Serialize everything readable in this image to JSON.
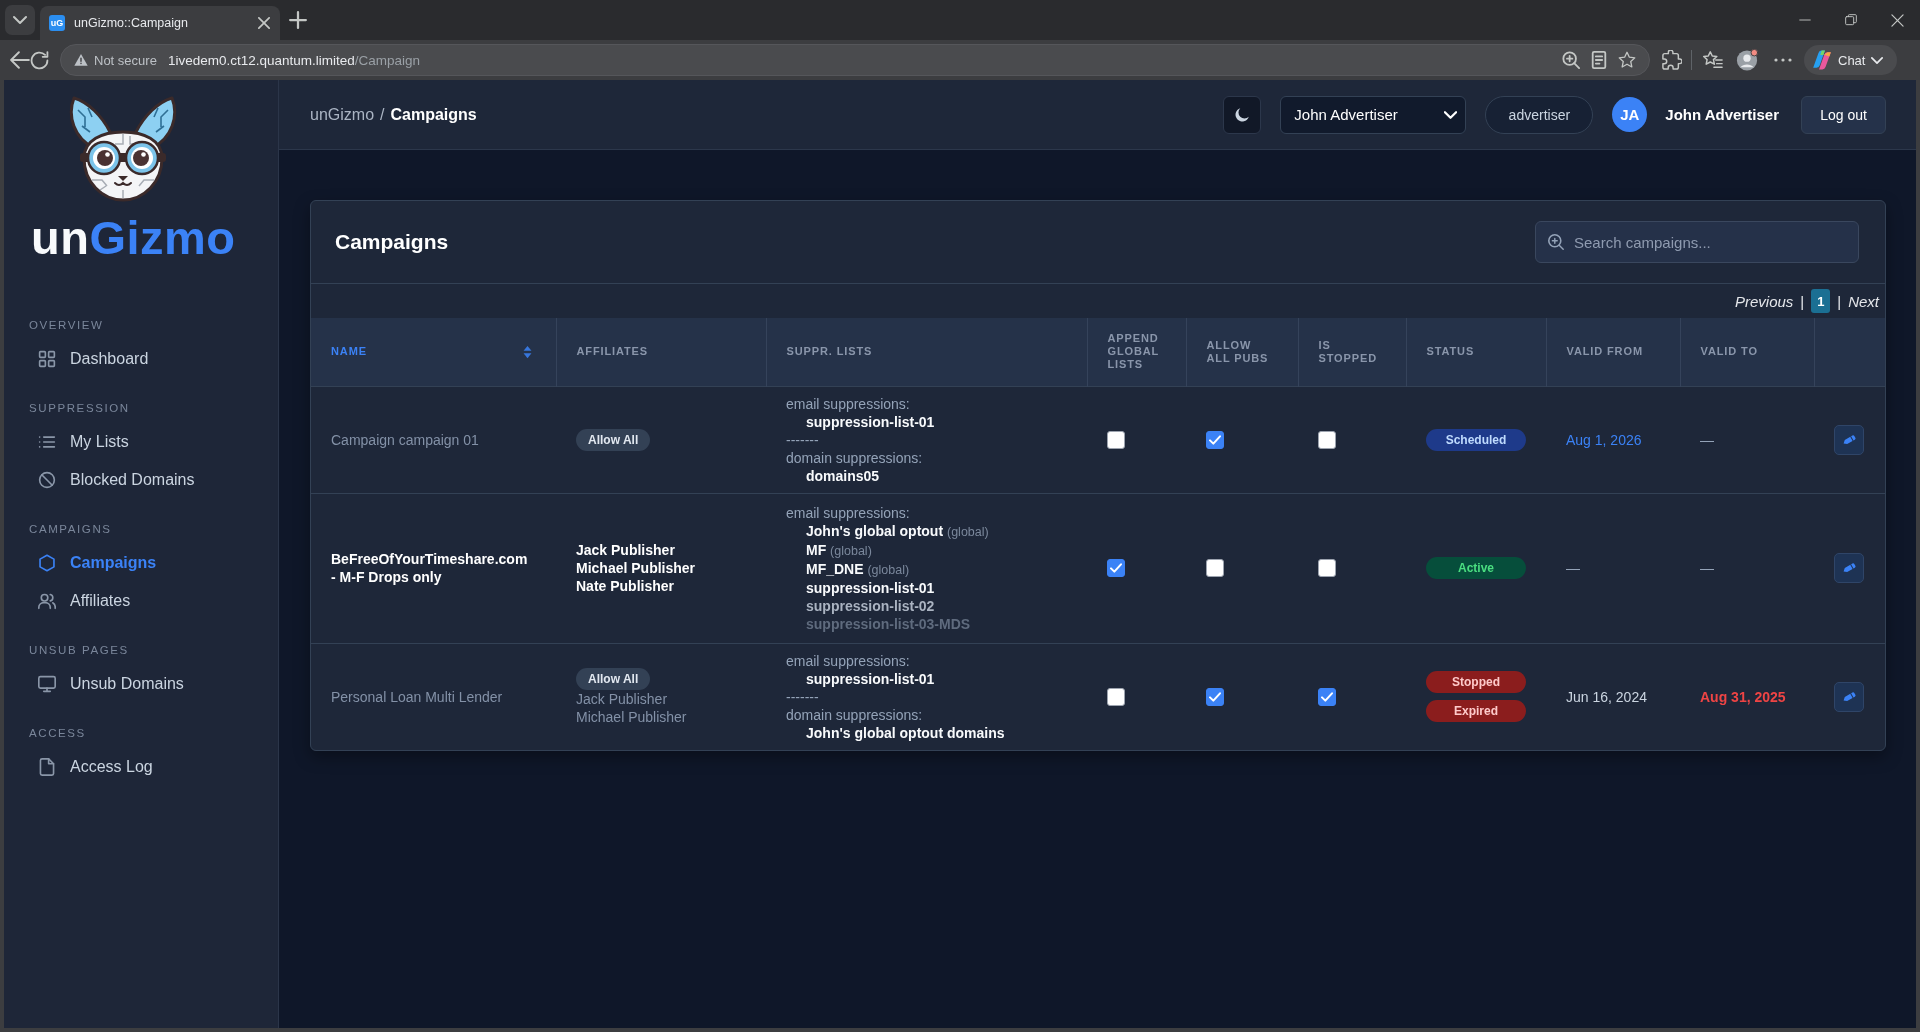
{
  "browser": {
    "tab": {
      "favicon": "uG",
      "title": "unGizmo::Campaign"
    },
    "address": {
      "security": "Not secure",
      "host": "1ivedem0.ct12.quantum.limited",
      "path": "/Campaign"
    },
    "chat": "Chat"
  },
  "sidebar": {
    "logo": {
      "wordmark_start": "un",
      "wordmark_end": "Gizmo"
    },
    "sections": [
      {
        "title": "OVERVIEW",
        "items": [
          {
            "label": "Dashboard",
            "selected": false
          }
        ]
      },
      {
        "title": "SUPPRESSION",
        "items": [
          {
            "label": "My Lists",
            "selected": false
          },
          {
            "label": "Blocked Domains",
            "selected": false
          }
        ]
      },
      {
        "title": "CAMPAIGNS",
        "items": [
          {
            "label": "Campaigns",
            "selected": true
          },
          {
            "label": "Affiliates",
            "selected": false
          }
        ]
      },
      {
        "title": "UNSUB PAGES",
        "items": [
          {
            "label": "Unsub Domains",
            "selected": false
          }
        ]
      },
      {
        "title": "ACCESS",
        "items": [
          {
            "label": "Access Log",
            "selected": false
          }
        ]
      }
    ]
  },
  "header": {
    "breadcrumb": [
      {
        "label": "unGizmo",
        "current": false
      },
      {
        "label": "Campaigns",
        "current": true
      }
    ],
    "breadcrumb_separator": "/",
    "account_select": "John Advertiser",
    "role": "advertiser",
    "avatar_initials": "JA",
    "user_name": "John Advertiser",
    "logout": "Log out"
  },
  "card": {
    "title": "Campaigns",
    "search": {
      "placeholder": "Search campaigns..."
    },
    "pagination": {
      "previous": "Previous",
      "separators": [
        "|",
        "|"
      ],
      "pages": [
        {
          "label": "1",
          "selected": true
        }
      ],
      "next": "Next"
    },
    "table": {
      "columns": [
        {
          "label": "NAME",
          "sorted": true
        },
        {
          "label": "AFFILIATES",
          "sorted": false
        },
        {
          "label": "SUPPR. LISTS",
          "sorted": false
        },
        {
          "label": "APPEND GLOBAL LISTS",
          "sorted": false
        },
        {
          "label": "ALLOW ALL PUBS",
          "sorted": false
        },
        {
          "label": "IS STOPPED",
          "sorted": false
        },
        {
          "label": "STATUS",
          "sorted": false
        },
        {
          "label": "VALID FROM",
          "sorted": false
        },
        {
          "label": "VALID TO",
          "sorted": false
        }
      ],
      "rows": [
        {
          "name": "Campaign campaign 01",
          "inactive": true,
          "affiliates": {
            "badge": "Allow All"
          },
          "suppr_overflow": false,
          "suppr_lists": [
            {
              "kind": "heading",
              "text": "email suppressions:"
            },
            {
              "kind": "list",
              "text": "suppression-list-01"
            },
            {
              "kind": "divider",
              "text": "-------"
            },
            {
              "kind": "heading",
              "text": "domain suppressions:"
            },
            {
              "kind": "list",
              "text": "domains05"
            }
          ],
          "append_global": false,
          "allow_all_pubs": true,
          "is_stopped": false,
          "status": [
            {
              "label": "Scheduled",
              "kind": "scheduled"
            }
          ],
          "valid_from": {
            "text": "Aug 1, 2026",
            "kind": "future"
          },
          "valid_to": {
            "text": "—",
            "kind": "none"
          }
        },
        {
          "name": "BeFreeOfYourTimeshare.com - M-F Drops only",
          "inactive": false,
          "affiliates": {
            "names": [
              "Jack Publisher",
              "Michael Publisher",
              "Nate Publisher"
            ]
          },
          "suppr_overflow": true,
          "suppr_lists": [
            {
              "kind": "heading",
              "text": "email suppressions:"
            },
            {
              "kind": "list",
              "text": "John's global optout",
              "tag": "(global)"
            },
            {
              "kind": "list",
              "text": "MF",
              "tag": "(global)"
            },
            {
              "kind": "list",
              "text": "MF_DNE",
              "tag": "(global)"
            },
            {
              "kind": "list",
              "text": "suppression-list-01"
            },
            {
              "kind": "list",
              "text": "suppression-list-02"
            },
            {
              "kind": "list",
              "text": "suppression-list-03-MDS"
            }
          ],
          "append_global": true,
          "allow_all_pubs": false,
          "is_stopped": false,
          "status": [
            {
              "label": "Active",
              "kind": "active"
            }
          ],
          "valid_from": {
            "text": "—",
            "kind": "none"
          },
          "valid_to": {
            "text": "—",
            "kind": "none"
          }
        },
        {
          "name": "Personal Loan Multi Lender",
          "inactive": true,
          "affiliates": {
            "badge": "Allow All",
            "names": [
              "Jack Publisher",
              "Michael Publisher"
            ]
          },
          "suppr_overflow": false,
          "suppr_lists": [
            {
              "kind": "heading",
              "text": "email suppressions:"
            },
            {
              "kind": "list",
              "text": "suppression-list-01"
            },
            {
              "kind": "divider",
              "text": "-------"
            },
            {
              "kind": "heading",
              "text": "domain suppressions:"
            },
            {
              "kind": "list",
              "text": "John's global optout domains"
            }
          ],
          "append_global": false,
          "allow_all_pubs": true,
          "is_stopped": true,
          "status": [
            {
              "label": "Stopped",
              "kind": "stopped"
            },
            {
              "label": "Expired",
              "kind": "expired"
            }
          ],
          "valid_from": {
            "text": "Jun 16, 2024",
            "kind": "past"
          },
          "valid_to": {
            "text": "Aug 31, 2025",
            "kind": "expired"
          }
        }
      ]
    }
  }
}
